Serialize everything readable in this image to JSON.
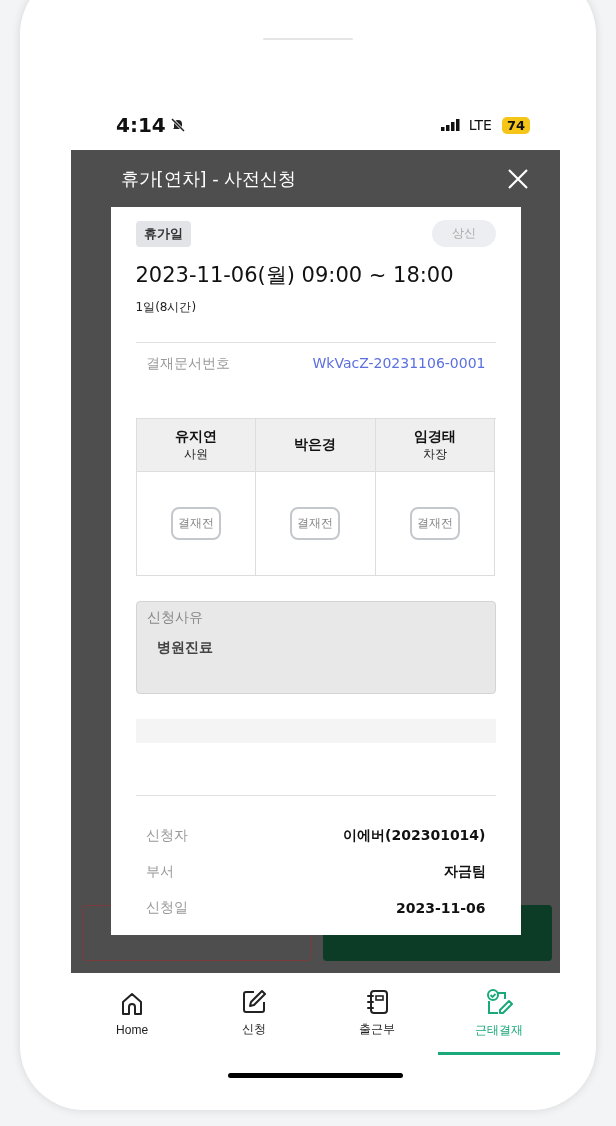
{
  "status_bar": {
    "time": "4:14",
    "network": "LTE",
    "battery": "74"
  },
  "modal": {
    "title": "휴가[연차] - 사전신청",
    "tag": "휴가일",
    "submit_button": {
      "label": "상신",
      "disabled": true
    },
    "date_range": "2023-11-06(월) 09:00 ~ 18:00",
    "duration": "1일(8시간)",
    "document_number": {
      "label": "결재문서번호",
      "value": "WkVacZ-20231106-0001"
    },
    "approvers": [
      {
        "name": "유지연",
        "position": "사원",
        "status": "결재전"
      },
      {
        "name": "박은경",
        "status": "결재전"
      },
      {
        "name": "임경태",
        "position": "차장",
        "status": "결재전"
      }
    ],
    "reason": {
      "label": "신청사유",
      "value": "병원진료"
    },
    "details": [
      {
        "label": "신청자",
        "value": "이에버(202301014)"
      },
      {
        "label": "부서",
        "value": "자금팀"
      },
      {
        "label": "신청일",
        "value": "2023-11-06"
      }
    ]
  },
  "nav": [
    {
      "label": "Home",
      "kind": "home",
      "selected": false
    },
    {
      "label": "신청",
      "kind": "edit",
      "selected": false
    },
    {
      "label": "출근부",
      "kind": "notebook",
      "selected": false
    },
    {
      "label": "근태결재",
      "kind": "approval",
      "selected": true
    }
  ]
}
